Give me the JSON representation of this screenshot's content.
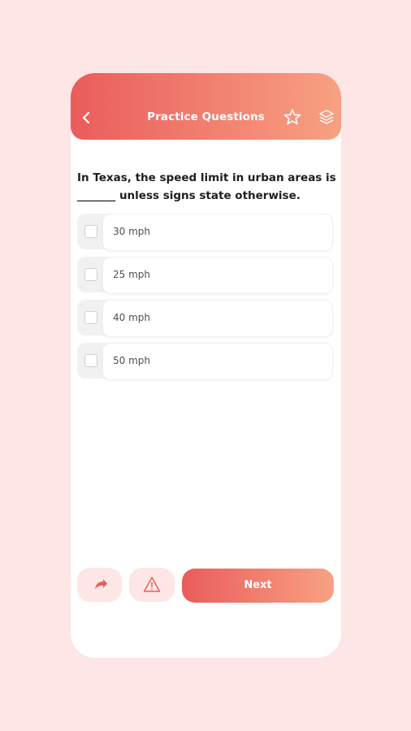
{
  "header": {
    "title": "Practice Questions",
    "back_icon": "chevron-left-icon",
    "bookmark_icon": "star-icon",
    "menu_icon": "layers-icon"
  },
  "question": {
    "text": "In Texas, the speed limit in urban areas is _______ unless signs state otherwise."
  },
  "options": [
    {
      "label": "30 mph",
      "checked": false
    },
    {
      "label": "25 mph",
      "checked": false
    },
    {
      "label": "40 mph",
      "checked": false
    },
    {
      "label": "50 mph",
      "checked": false
    }
  ],
  "footer": {
    "share_icon": "share-arrow-icon",
    "report_icon": "warning-triangle-icon",
    "next_label": "Next"
  },
  "colors": {
    "gradient_start": "#ea5c5c",
    "gradient_end": "#f8a182",
    "background": "#fde6e5"
  }
}
